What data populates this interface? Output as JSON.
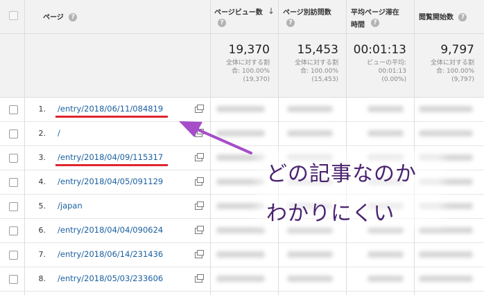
{
  "header": {
    "page_label": "ページ",
    "col1": "ページビュー数",
    "col2": "ページ別訪問数",
    "col3_line1": "平均ページ滞在",
    "col3_line2": "時間",
    "col4": "閲覧開始数",
    "help": "?"
  },
  "totals": [
    {
      "value": "19,370",
      "l1": "全体に対する割",
      "l2": "合: 100.00%",
      "l3": "(19,370)"
    },
    {
      "value": "15,453",
      "l1": "全体に対する割",
      "l2": "合: 100.00%",
      "l3": "(15,453)"
    },
    {
      "value": "00:01:13",
      "l1": "ビューの平均:",
      "l2": "00:01:13",
      "l3": "(0.00%)"
    },
    {
      "value": "9,797",
      "l1": "全体に対する割",
      "l2": "合: 100.00%",
      "l3": "(9,797)"
    }
  ],
  "rows": [
    {
      "num": "1.",
      "page": "/entry/2018/06/11/084819"
    },
    {
      "num": "2.",
      "page": "/"
    },
    {
      "num": "3.",
      "page": "/entry/2018/04/09/115317"
    },
    {
      "num": "4.",
      "page": "/entry/2018/04/05/091129"
    },
    {
      "num": "5.",
      "page": "/japan"
    },
    {
      "num": "6.",
      "page": "/entry/2018/04/04/090624"
    },
    {
      "num": "7.",
      "page": "/entry/2018/06/14/231436"
    },
    {
      "num": "8.",
      "page": "/entry/2018/05/03/233606"
    }
  ],
  "annotation": {
    "line1": "どの記事なのか",
    "line2": "わかりにくい",
    "text_color": "#4a2370",
    "arrow_color": "#a64dc9",
    "underline_color": "#e0242d"
  }
}
